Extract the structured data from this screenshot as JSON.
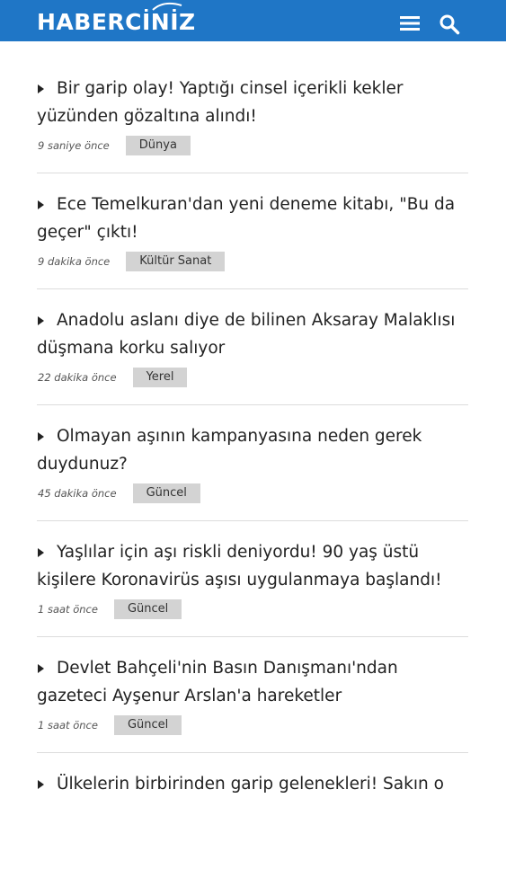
{
  "header": {
    "logo_text": "HABERCİNİZ",
    "menu_icon": "hamburger-menu-icon",
    "search_icon": "search-icon",
    "bg_color": "#1f76c6"
  },
  "news": [
    {
      "title": "Bir garip olay! Yaptığı cinsel içerikli kekler yüzünden gözaltına alındı!",
      "time": "9 saniye önce",
      "category": "Dünya"
    },
    {
      "title": "Ece Temelkuran'dan yeni deneme kitabı, \"Bu da geçer\" çıktı!",
      "time": "9 dakika önce",
      "category": "Kültür Sanat"
    },
    {
      "title": "Anadolu aslanı diye de bilinen Aksaray Malaklısı düşmana korku salıyor",
      "time": "22 dakika önce",
      "category": "Yerel"
    },
    {
      "title": "Olmayan aşının kampanyasına neden gerek duydunuz?",
      "time": "45 dakika önce",
      "category": "Güncel"
    },
    {
      "title": "Yaşlılar için aşı riskli deniyordu! 90 yaş üstü kişilere Koronavirüs aşısı uygulanmaya başlandı!",
      "time": "1 saat önce",
      "category": "Güncel"
    },
    {
      "title": "Devlet Bahçeli'nin Basın Danışmanı'ndan gazeteci Ayşenur Arslan'a hareketler",
      "time": "1 saat önce",
      "category": "Güncel"
    },
    {
      "title": "Ülkelerin birbirinden garip gelenekleri! Sakın o",
      "time": "",
      "category": ""
    }
  ]
}
